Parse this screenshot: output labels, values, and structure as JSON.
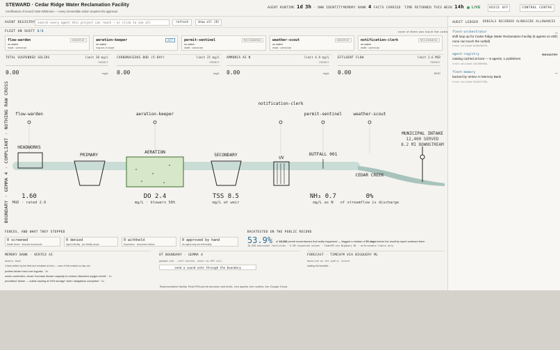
{
  "header": {
    "title": "STEWARD · Cedar Ridge Water Reclamation Facility",
    "subtitle": "Certification of record: Dale Whitmore — every irreversible action requires his approval.",
    "runtime_label": "AGENT RUNTIME",
    "runtime_d": "1d",
    "runtime_h": "3h",
    "runtime_suffix": "· OWN IDENTITY",
    "memory_label": "MEMORY BANK",
    "memory_count": "4",
    "memory_suffix": "FACTS CARRIED",
    "returned_label": "TIME RETURNED THIS WEEK",
    "returned_value": "14h",
    "live": "LIVE",
    "voice_btn": "VOICE OFF",
    "control_btn": "CONTROL CENTRE"
  },
  "registry": {
    "label": "AGENT REGISTRY",
    "search_placeholder": "search every agent this project can reach — or click to see all",
    "refresh": "refresh",
    "show_all": "show all (8)"
  },
  "fleet": {
    "label": "FLEET ON SHIFT",
    "count": "5/5",
    "note": "none of them can touch the outfall",
    "agents": [
      {
        "name": "flow-warden",
        "status": "on watch",
        "scope": "reads · cannot act",
        "badge": "OBSERVE"
      },
      {
        "name": "aeration-keeper",
        "status": "on watch",
        "scope": "may act, in scope",
        "badge": "ACT"
      },
      {
        "name": "permit-sentinel",
        "status": "on watch",
        "scope": "drafts · cannot act",
        "badge": "RECOMMEND"
      },
      {
        "name": "weather-scout",
        "status": "on watch",
        "scope": "reads · cannot act",
        "badge": "OBSERVE"
      },
      {
        "name": "notification-clerk",
        "status": "on watch",
        "scope": "drafts · cannot act",
        "badge": "RECOMMEND"
      }
    ]
  },
  "metrics": [
    {
      "name": "TOTAL SUSPENDED SOLIDS",
      "limit": "limit 30 mg/L",
      "permit": "PERMIT",
      "value": "0.00",
      "unit": "mg/L"
    },
    {
      "name": "CARBONACEOUS BOD (5-DAY)",
      "limit": "limit 25 mg/L",
      "permit": "PERMIT",
      "value": "0.00",
      "unit": "mg/L"
    },
    {
      "name": "AMMONIA AS N",
      "limit": "limit 4.9 mg/L",
      "permit": "PERMIT",
      "value": "0.00",
      "unit": "mg/L"
    },
    {
      "name": "EFFLUENT FLOW",
      "limit": "limit 2.6 MGD",
      "permit": "PERMIT",
      "value": "0.00",
      "unit": "MGD"
    }
  ],
  "diagram": {
    "side_label": "OT BOUNDARY · GEMMA 4 · COMPLIANT · NOTHING RAW CROSSES",
    "agents": {
      "flow": "flow-warden",
      "aer": "aeration-keeper",
      "notif": "notification-clerk",
      "permit": "permit-sentinel",
      "weather": "weather-scout"
    },
    "stages": {
      "headworks": "HEADWORKS",
      "primary": "PRIMARY",
      "aeration": "AERATION",
      "secondary": "SECONDARY",
      "uv": "UV",
      "outfall": "OUTFALL 001",
      "creek": "CEDAR CREEK",
      "intake": "MUNICIPAL INTAKE"
    },
    "intake_served": "12,400 SERVED",
    "intake_dist": "8.2 MI DOWNSTREAM",
    "readouts": [
      {
        "value": "1.60",
        "label": "MGD · rated 2.6"
      },
      {
        "value": "DO 2.4",
        "label": "mg/L · blowers 58%"
      },
      {
        "value": "TSS 8.5",
        "label": "mg/L at weir"
      },
      {
        "value": "NH₃ 0.7",
        "label": "mg/L as N"
      },
      {
        "value": "0%",
        "label": "of streamflow is discharge"
      }
    ]
  },
  "fences": {
    "title": "FENCES, AND WHAT THEY STOPPED",
    "items": [
      {
        "value": "0 screened",
        "desc": "Model Armor · inbound documents"
      },
      {
        "value": "0 denied",
        "desc": "Agent Identity · per-facility scope"
      },
      {
        "value": "0 withheld",
        "desc": "Supervisor · unsourced claims"
      },
      {
        "value": "0 approved by hand",
        "desc": "No agent may act irreversibly"
      }
    ]
  },
  "backtest": {
    "title": "BACKTESTED ON THE PUBLIC RECORD",
    "pct": "53.9%",
    "line1_a": "of ",
    "line1_b": "18,338",
    "line1_c": " permit exceedances that really happened — flagged a median of ",
    "line1_d": "51 days",
    "line1_e": " before the monthly report surfaced them",
    "line2": "10,356 municipal facilities · 6.9M inspected values · TimesFM via BigQuery ML · enforceable limits only"
  },
  "memory": {
    "title": "MEMORY BANK · VERTEX AI",
    "sub": "memory bank",
    "note": "4 facts written by the fleet and reloaded at boot — none of this existed on day one",
    "facts": [
      "prefers tanker haul over bypass · 1×",
      "under contention, chose 'increase blower capacity to restore dissolved oxygen levels' · 1×",
      "prioritised 'tanker → solids hauling at 94% storage' when obligations competed · 1×"
    ]
  },
  "ot": {
    "title": "OT BOUNDARY · GEMMA 4",
    "sub": "gemma4-e2b · self-hosted, never an API call",
    "button": "send a sound note through the boundary"
  },
  "forecast": {
    "title": "FORECAST · TIMESFM VIA BIGQUERY ML",
    "sub": "measured on the public record",
    "loading": "loading the backtest…"
  },
  "footer": "Representative facility. Real EPA permit structure and limits. Live agents, live models, live Google Cloud.",
  "audit": {
    "title": "AUDIT LEDGER",
    "tag": "DENIALS RECORDED ALONGSIDE ALLOWANCES",
    "entries": [
      {
        "name": "fleet-orchestrator",
        "desc": "shift loop up for Cedar Ridge Water Reclamation Facility (5 agents on shift; none can touch the outfall)",
        "trace": "trace unlinked·02a6e3b5f8…",
        "badge": "—"
      },
      {
        "name": "agent-registry",
        "desc": "catalog cached at boot — 5 agents, 1 publishers",
        "trace": "trace unlinked·2d12869f8e…",
        "badge": "REGISTRY"
      },
      {
        "name": "fleet-memory",
        "desc": "backed by Vertex AI Memory Bank",
        "trace": "trace unlinked·6e3d5f2766…",
        "badge": "—"
      }
    ]
  },
  "colors": {
    "accent": "#2f6c95",
    "live": "#3aa55e",
    "water": "#c9dcd6",
    "aeration": "#d7e7c9"
  }
}
